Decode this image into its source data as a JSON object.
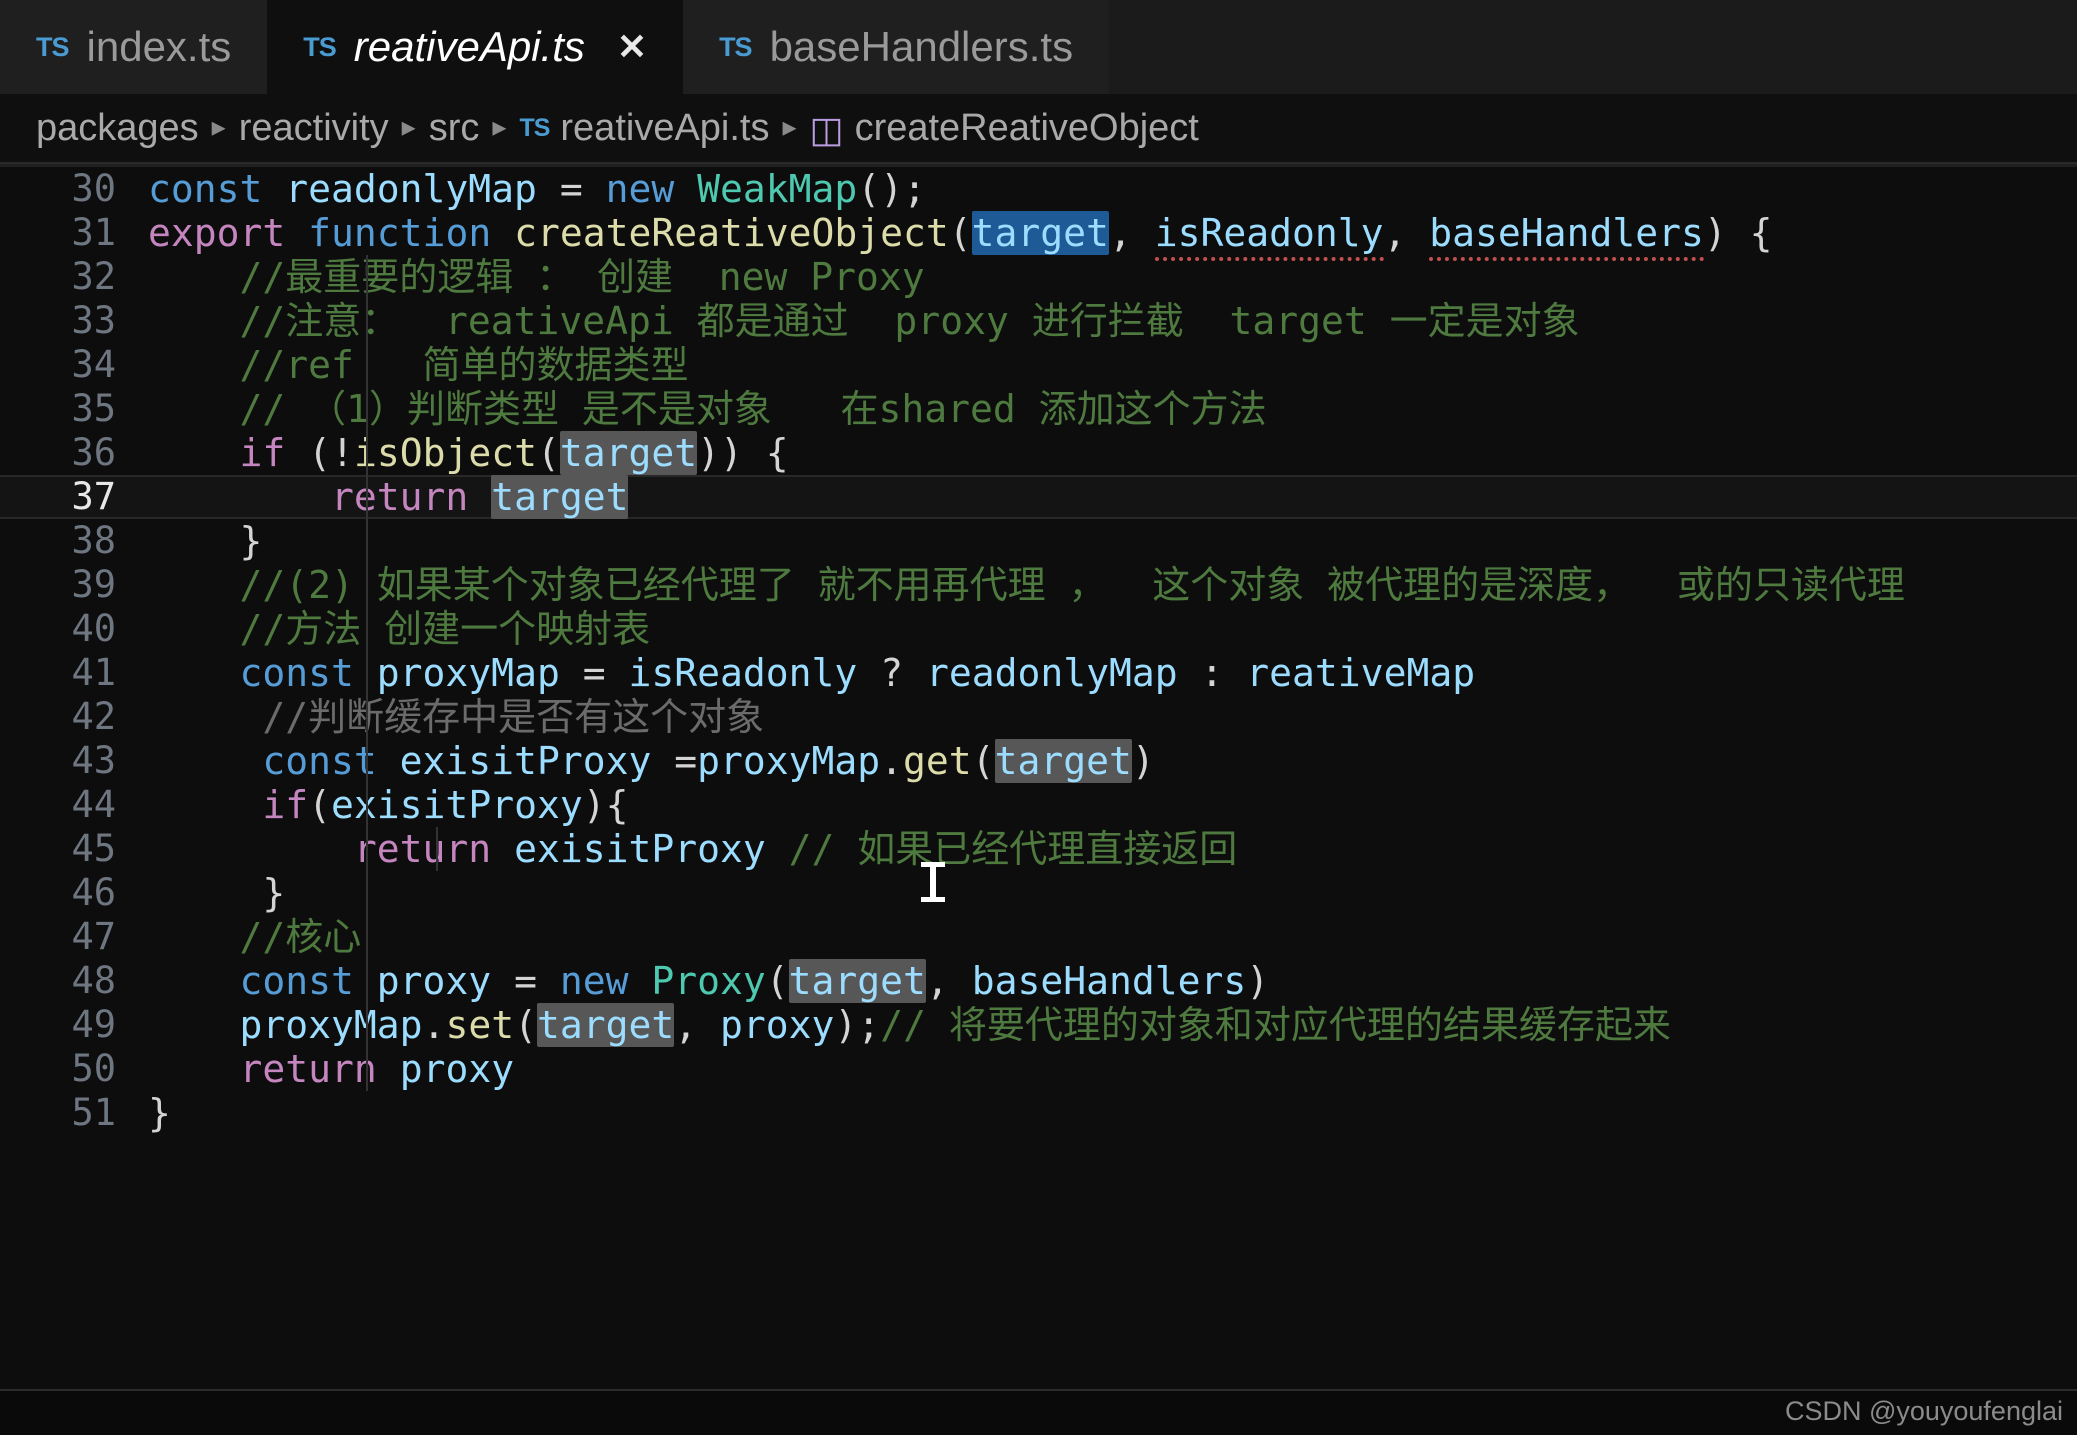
{
  "tabs": [
    {
      "icon": "TS",
      "label": "index.ts",
      "active": false,
      "closable": false
    },
    {
      "icon": "TS",
      "label": "reativeApi.ts",
      "active": true,
      "closable": true,
      "close_label": "✕"
    },
    {
      "icon": "TS",
      "label": "baseHandlers.ts",
      "active": false,
      "closable": false
    }
  ],
  "breadcrumb": {
    "separator": "▸",
    "items": [
      {
        "label": "packages",
        "icon": null
      },
      {
        "label": "reactivity",
        "icon": null
      },
      {
        "label": "src",
        "icon": null
      },
      {
        "label": "reativeApi.ts",
        "icon": "TS"
      },
      {
        "label": "createReativeObject",
        "icon": "cube"
      }
    ]
  },
  "editor": {
    "active_line_number": 37,
    "first_line": 30,
    "lines": [
      {
        "n": "30"
      },
      {
        "n": "31"
      },
      {
        "n": "32"
      },
      {
        "n": "33"
      },
      {
        "n": "34"
      },
      {
        "n": "35"
      },
      {
        "n": "36"
      },
      {
        "n": "37"
      },
      {
        "n": "38"
      },
      {
        "n": "39"
      },
      {
        "n": "40"
      },
      {
        "n": "41"
      },
      {
        "n": "42"
      },
      {
        "n": "43"
      },
      {
        "n": "44"
      },
      {
        "n": "45"
      },
      {
        "n": "46"
      },
      {
        "n": "47"
      },
      {
        "n": "48"
      },
      {
        "n": "49"
      },
      {
        "n": "50"
      },
      {
        "n": "51"
      }
    ],
    "source": [
      "const readonlyMap = new WeakMap();",
      "export function createReativeObject(target, isReadonly, baseHandlers) {",
      "    //最重要的逻辑 ： 创建  new Proxy",
      "    //注意：  reativeApi 都是通过  proxy 进行拦截  target 一定是对象",
      "    //ref   简单的数据类型",
      "    // （1）判断类型 是不是对象   在shared 添加这个方法",
      "    if (!isObject(target)) {",
      "        return target",
      "    }",
      "    //(2) 如果某个对象已经代理了 就不用再代理 ，  这个对象 被代理的是深度，  或的只读代理",
      "    //方法 创建一个映射表",
      "    const proxyMap = isReadonly ? readonlyMap : reativeMap",
      "     //判断缓存中是否有这个对象",
      "     const exisitProxy =proxyMap.get(target)",
      "     if(exisitProxy){",
      "         return exisitProxy // 如果已经代理直接返回",
      "     }",
      "    //核心",
      "    const proxy = new Proxy(target, baseHandlers)",
      "    proxyMap.set(target, proxy);// 将要代理的对象和对应代理的结果缓存起来",
      "    return proxy",
      "}"
    ],
    "highlighted_symbol": "target",
    "selected_symbol": "target"
  },
  "watermark": "CSDN @youyoufenglai",
  "colors": {
    "background": "#0d0d0d",
    "tab_active_bg": "#0f0f0f",
    "tab_inactive_bg": "#1f1f1f",
    "keyword": "#c586c0",
    "keyword_blue": "#569cd6",
    "identifier": "#9cdcfe",
    "function": "#dcdcaa",
    "type": "#4ec9b0",
    "comment": "#4f7a3f",
    "comment_dim": "#6b6b6b",
    "selection": "#1d5a96",
    "word_highlight": "#575757",
    "ts_icon": "#4a9bd1",
    "symbol_cube": "#b99de0"
  }
}
